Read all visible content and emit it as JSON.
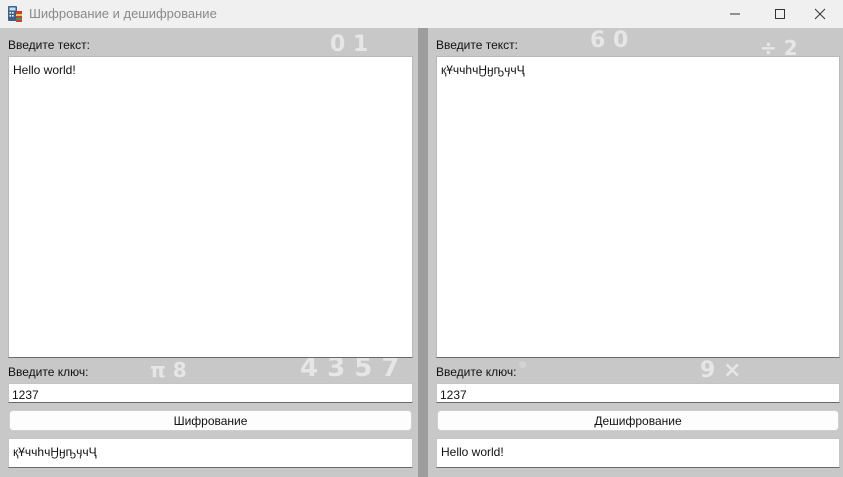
{
  "window": {
    "title": "Шифрование и дешифрование",
    "icon": "calculator-books-icon",
    "controls": [
      "minimize-icon",
      "maximize-icon",
      "close-icon"
    ]
  },
  "encrypt_panel": {
    "text_label": "Введите текст:",
    "text_value": "Hello world!",
    "key_label": "Введите ключ:",
    "key_value": "1237",
    "button_label": "Шифрование",
    "result_value": "қҰччһчӇӈҧӌчҶ"
  },
  "decrypt_panel": {
    "text_label": "Введите текст:",
    "text_value": "қҰччһчӇӈҧӌчҶ",
    "key_label": "Введите ключ:",
    "key_value": "1237",
    "button_label": "Дешифрование",
    "result_value": "Hello world!"
  },
  "colors": {
    "window_background": "#c8c8c8",
    "separator": "#9d9d9d",
    "titlebar": "#f0f0f0"
  }
}
